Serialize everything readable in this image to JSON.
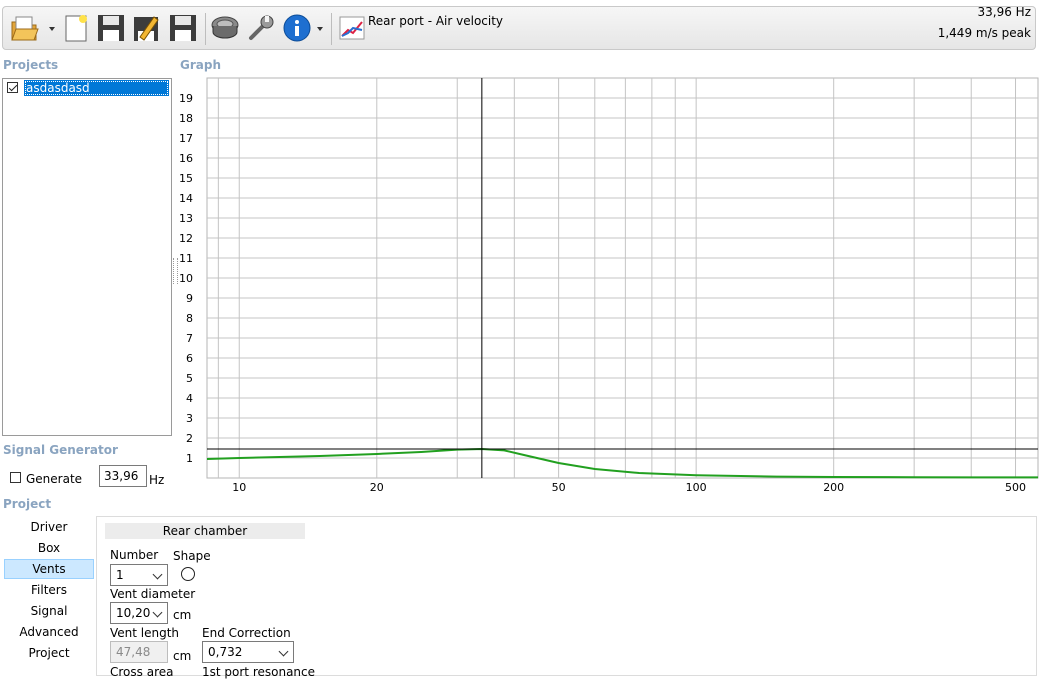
{
  "toolbar": {
    "graph_name": "Rear port - Air velocity",
    "readout_frequency": "33,96 Hz",
    "readout_value": "1,449 m/s peak",
    "icons": [
      "open-folder-icon",
      "new-file-icon",
      "save-icon",
      "edit-icon",
      "save-all-icon",
      "driver-icon",
      "wrench-icon",
      "info-icon",
      "graph-icon"
    ]
  },
  "projects": {
    "title": "Projects",
    "items": [
      {
        "name": "asdasdasd",
        "checked": true
      }
    ]
  },
  "graph": {
    "title": "Graph"
  },
  "signal_generator": {
    "title": "Signal Generator",
    "generate_label": "Generate",
    "frequency_value": "33,96",
    "unit": "Hz"
  },
  "project_nav": {
    "title": "Project",
    "items": [
      "Driver",
      "Box",
      "Vents",
      "Filters",
      "Signal",
      "Advanced",
      "Project"
    ],
    "active": "Vents"
  },
  "panel": {
    "chamber": "Rear chamber",
    "number_label": "Number",
    "number_value": "1",
    "shape_label": "Shape",
    "vent_diameter_label": "Vent diameter",
    "vent_diameter_value": "10,20",
    "vent_diameter_unit": "cm",
    "vent_length_label": "Vent length",
    "vent_length_value": "47,48",
    "vent_length_unit": "cm",
    "end_correction_label": "End Correction",
    "end_correction_value": "0,732",
    "cross_area_label": "Cross area",
    "port_resonance_label": "1st port resonance"
  },
  "chart_data": {
    "type": "line",
    "x_scale": "log",
    "xlim": [
      8.5,
      560
    ],
    "ylim": [
      0,
      20
    ],
    "x_ticks": [
      10,
      20,
      50,
      100,
      200,
      500
    ],
    "x_tick_labels": [
      "10",
      "20",
      "50",
      "100",
      "200",
      "500"
    ],
    "y_ticks": [
      1,
      2,
      3,
      4,
      5,
      6,
      7,
      8,
      9,
      10,
      11,
      12,
      13,
      14,
      15,
      16,
      17,
      18,
      19
    ],
    "grid": true,
    "cursor_x": 33.96,
    "cursor_y": 1.449,
    "series": [
      {
        "color": "#22a020",
        "x": [
          8.5,
          10,
          15,
          20,
          25,
          30,
          33.96,
          38,
          42,
          50,
          60,
          75,
          100,
          150,
          200,
          300,
          400,
          560
        ],
        "y": [
          0.95,
          1.0,
          1.1,
          1.2,
          1.3,
          1.42,
          1.449,
          1.38,
          1.15,
          0.75,
          0.45,
          0.25,
          0.14,
          0.07,
          0.05,
          0.04,
          0.03,
          0.03
        ]
      }
    ]
  }
}
